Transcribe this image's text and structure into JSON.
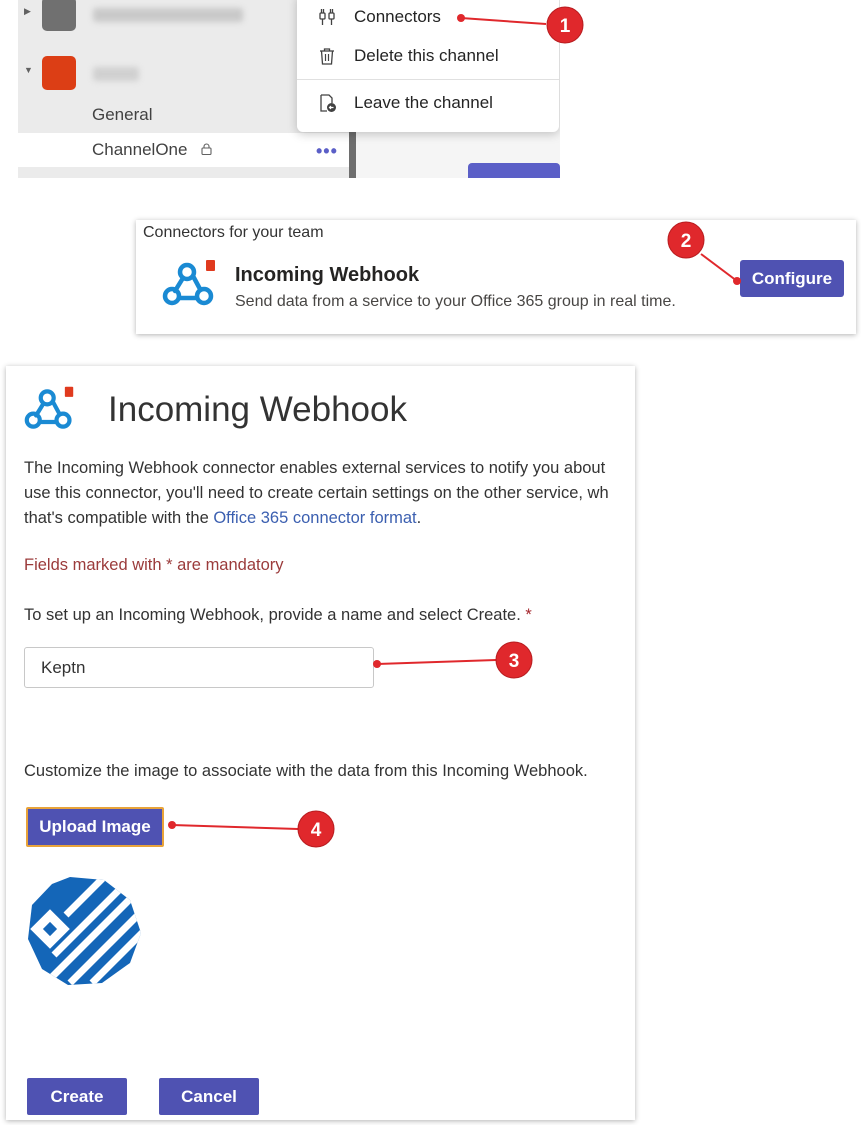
{
  "teams_sidebar": {
    "channels": [
      {
        "name": "General"
      },
      {
        "name": "ChannelOne"
      }
    ],
    "colors": {
      "team1_avatar": "#707070",
      "team2_avatar": "#dc3e15",
      "accent": "#5b5fc7"
    }
  },
  "channel_menu": {
    "items": [
      {
        "label": "Connectors",
        "icon": "connectors-icon"
      },
      {
        "label": "Delete this channel",
        "icon": "trash-icon"
      },
      {
        "label": "Leave the channel",
        "icon": "leave-icon"
      }
    ]
  },
  "connectors_card": {
    "header": "Connectors for your team",
    "title": "Incoming Webhook",
    "description": "Send data from a service to your Office 365 group in real time.",
    "configure_label": "Configure",
    "icon": "webhook-icon"
  },
  "webhook_form": {
    "title": "Incoming Webhook",
    "intro_line1": "The Incoming Webhook connector enables external services to notify you about",
    "intro_line2": "use this connector, you'll need to create certain settings on the other service, wh",
    "intro_line3_pre": "that's compatible with the ",
    "intro_link": "Office 365 connector format",
    "intro_line3_post": ".",
    "mandatory_note": "Fields marked with * are mandatory",
    "name_label": "To set up an Incoming Webhook, provide a name and select Create.",
    "required_mark": "*",
    "name_value": "Keptn",
    "customize_label": "Customize the image to associate with the data from this Incoming Webhook.",
    "upload_label": "Upload Image",
    "create_label": "Create",
    "cancel_label": "Cancel",
    "image_icon": "keptn-logo"
  },
  "annotations": {
    "badges": [
      "1",
      "2",
      "3",
      "4"
    ],
    "color": "#e0282c"
  }
}
